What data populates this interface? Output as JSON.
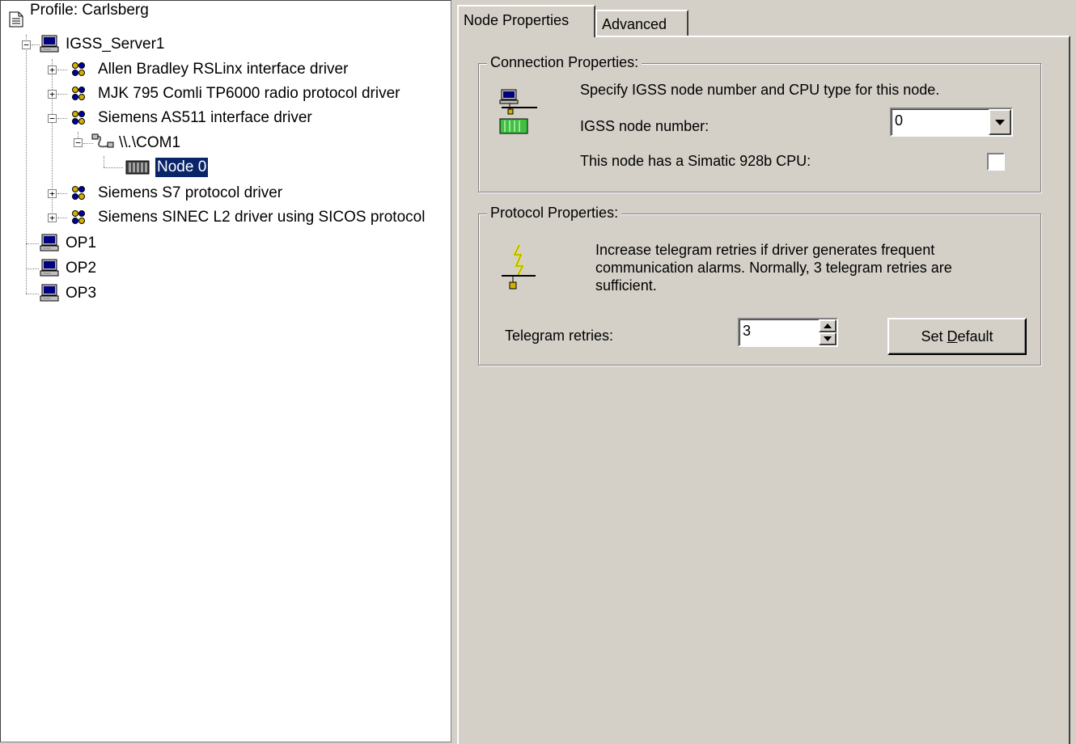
{
  "tree": {
    "root": "Profile: Carlsberg",
    "server": "IGSS_Server1",
    "drivers": [
      "Allen Bradley RSLinx interface driver",
      "MJK 795 Comli TP6000 radio protocol driver",
      "Siemens AS511 interface driver",
      "Siemens S7 protocol driver",
      "Siemens SINEC L2 driver using SICOS protocol"
    ],
    "port": "\\\\.\\COM1",
    "node": "Node 0",
    "operators": [
      "OP1",
      "OP2",
      "OP3"
    ],
    "expand_plus": "+",
    "expand_minus": "−"
  },
  "tabs": [
    {
      "label": "Node Properties",
      "active": true
    },
    {
      "label": "Advanced",
      "active": false
    }
  ],
  "connection": {
    "title": "Connection Properties:",
    "description": "Specify IGSS node number and CPU type for this node.",
    "node_number_label": "IGSS node number:",
    "node_number_value": "0",
    "cpu_label": "This node has a Simatic 928b CPU:",
    "cpu_checked": false
  },
  "protocol": {
    "title": "Protocol Properties:",
    "description_lines": [
      "Increase telegram retries if driver generates frequent",
      "communication alarms. Normally, 3 telegram retries are",
      "sufficient."
    ],
    "retries_label": "Telegram retries:",
    "retries_value": "3",
    "set_default_prefix": "Set ",
    "set_default_hotkey": "D",
    "set_default_suffix": "efault"
  },
  "colors": {
    "face": "#d4d0c8",
    "selection": "#0a246a",
    "driver_icon": "#d4b000"
  }
}
